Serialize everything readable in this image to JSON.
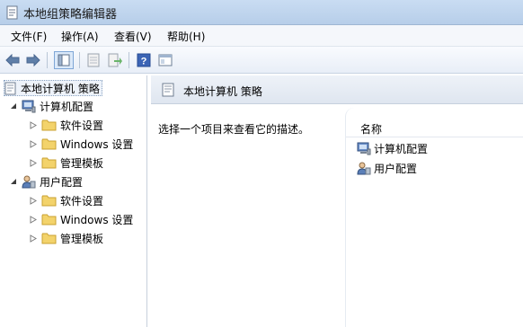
{
  "window": {
    "title": "本地组策略编辑器"
  },
  "menu": [
    {
      "label": "文件(F)"
    },
    {
      "label": "操作(A)"
    },
    {
      "label": "查看(V)"
    },
    {
      "label": "帮助(H)"
    }
  ],
  "toolbar": {
    "icons": [
      "back-icon",
      "forward-icon",
      "show-tree-icon",
      "properties-icon",
      "export-icon",
      "help-icon",
      "console-icon"
    ]
  },
  "tree": {
    "root": "本地计算机 策略",
    "computer": {
      "label": "计算机配置",
      "children": [
        "软件设置",
        "Windows 设置",
        "管理模板"
      ]
    },
    "user": {
      "label": "用户配置",
      "children": [
        "软件设置",
        "Windows 设置",
        "管理模板"
      ]
    }
  },
  "details": {
    "header_title": "本地计算机 策略",
    "description_prompt": "选择一个项目来查看它的描述。",
    "column_name": "名称",
    "items": [
      "计算机配置",
      "用户配置"
    ]
  },
  "colors": {
    "titlebar": "#c9dcf2",
    "folder": "#f3d36b",
    "selection_border": "#8aa3c2"
  }
}
